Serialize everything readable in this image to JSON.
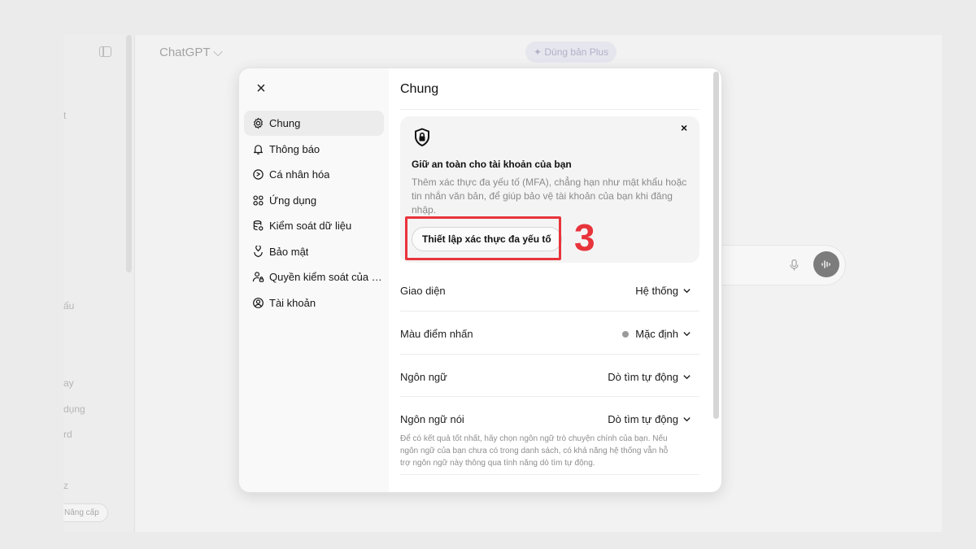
{
  "app": {
    "title": "ChatGPT ⌵",
    "plus_pill": "✦ Dùng bản Plus",
    "upgrade_label": "Nâng cấp",
    "sidebar_fragments": [
      "t",
      "ấu",
      "ay",
      "dụng",
      "rd",
      "z"
    ],
    "mic_icon": "mic-icon",
    "voice_icon": "voice-mode-icon"
  },
  "modal": {
    "close": "×",
    "nav": {
      "items": [
        {
          "label": "Chung",
          "icon": "gear-icon",
          "active": true
        },
        {
          "label": "Thông báo",
          "icon": "bell-icon"
        },
        {
          "label": "Cá nhân hóa",
          "icon": "personalize-icon"
        },
        {
          "label": "Ứng dụng",
          "icon": "apps-icon"
        },
        {
          "label": "Kiểm soát dữ liệu",
          "icon": "database-icon"
        },
        {
          "label": "Bảo mật",
          "icon": "security-icon"
        },
        {
          "label": "Quyền kiểm soát của c...",
          "icon": "parental-control-icon"
        },
        {
          "label": "Tài khoản",
          "icon": "account-icon"
        }
      ]
    },
    "content": {
      "title": "Chung",
      "mfa_card": {
        "heading": "Giữ an toàn cho tài khoản của bạn",
        "body": "Thêm xác thực đa yếu tố (MFA), chẳng hạn như mật khẩu hoặc tin nhắn văn bản, để giúp bảo vệ tài khoản của bạn khi đăng nhập.",
        "button": "Thiết lập xác thực đa yếu tố",
        "close": "×",
        "step_number": "3"
      },
      "settings": [
        {
          "label": "Giao diện",
          "value": "Hệ thống"
        },
        {
          "label": "Màu điểm nhấn",
          "value": "Mặc định"
        },
        {
          "label": "Ngôn ngữ",
          "value": "Dò tìm tự động"
        },
        {
          "label": "Ngôn ngữ nói",
          "value": "Dò tìm tự động",
          "hint": "Để có kết quả tốt nhất, hãy chọn ngôn ngữ trò chuyện chính của bạn. Nếu ngôn ngữ của bạn chưa có trong danh sách, có khả năng hệ thống vẫn hỗ trợ ngôn ngữ này thông qua tính năng dò tìm tự động."
        }
      ]
    }
  },
  "colors": {
    "highlight": "#e8343b",
    "accent_dot": "#9a9a9a",
    "card_bg": "#f4f4f4"
  }
}
